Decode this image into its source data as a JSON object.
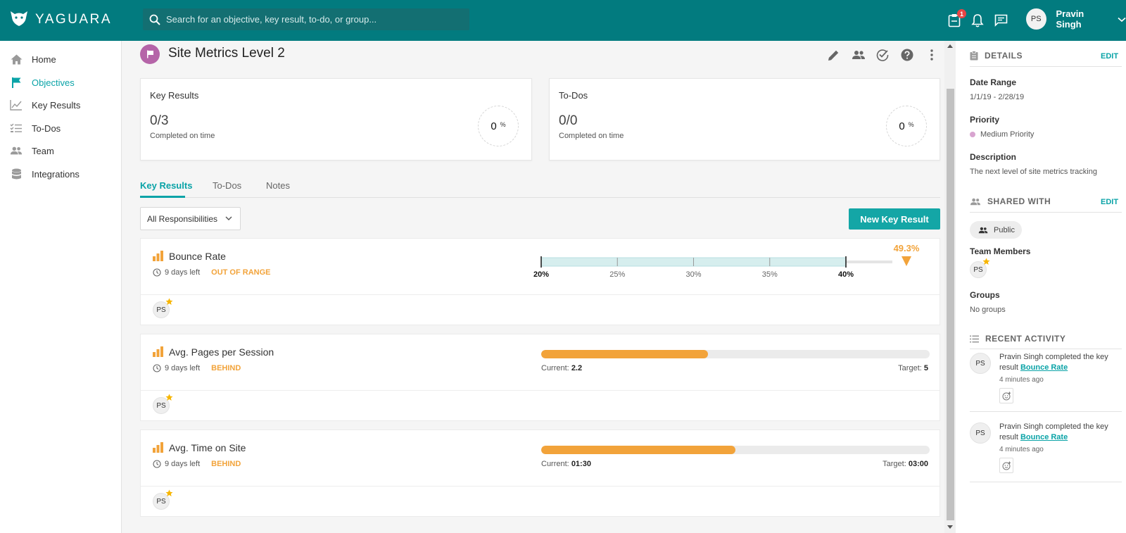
{
  "app": {
    "brand": "YAGUARA",
    "brand_color": "#027b7f",
    "accent": "#0aa3a7"
  },
  "search": {
    "placeholder": "Search for an objective, key result, to-do, or group..."
  },
  "topbar": {
    "notification_badge": "1",
    "user_initials": "PS",
    "user_name": "Pravin Singh"
  },
  "sidebar": {
    "items": [
      {
        "label": "Home",
        "icon": "home-icon"
      },
      {
        "label": "Objectives",
        "icon": "flag-icon"
      },
      {
        "label": "Key Results",
        "icon": "chart-line-icon"
      },
      {
        "label": "To-Dos",
        "icon": "checklist-icon"
      },
      {
        "label": "Team",
        "icon": "team-icon"
      },
      {
        "label": "Integrations",
        "icon": "database-icon"
      }
    ]
  },
  "objective": {
    "title": "Site Metrics Level 2"
  },
  "summary": {
    "key_results": {
      "title": "Key Results",
      "count": "0/3",
      "sub": "Completed on time",
      "percent": "0",
      "pct_symbol": "%"
    },
    "todos": {
      "title": "To-Dos",
      "count": "0/0",
      "sub": "Completed on time",
      "percent": "0",
      "pct_symbol": "%"
    }
  },
  "tabs": [
    "Key Results",
    "To-Dos",
    "Notes"
  ],
  "filter": {
    "label": "All Responsibilities"
  },
  "new_key_result": "New Key Result",
  "key_results": [
    {
      "name": "Bounce Rate",
      "days_left": "9 days left",
      "status": "OUT OF RANGE",
      "range": {
        "ticks": [
          "20%",
          "25%",
          "30%",
          "35%",
          "40%"
        ],
        "min": 20,
        "max": 40,
        "current": 49.3,
        "current_label": "49.3%"
      },
      "owner": "PS"
    },
    {
      "name": "Avg. Pages per Session",
      "days_left": "9 days left",
      "status": "BEHIND",
      "progress": {
        "current_prefix": "Current:",
        "current": "2.2",
        "target_prefix": "Target:",
        "target": "5",
        "fraction": 0.43
      },
      "owner": "PS"
    },
    {
      "name": "Avg. Time on Site",
      "days_left": "9 days left",
      "status": "BEHIND",
      "progress": {
        "current_prefix": "Current:",
        "current": "01:30",
        "target_prefix": "Target:",
        "target": "03:00",
        "fraction": 0.5
      },
      "owner": "PS"
    }
  ],
  "details": {
    "heading": "DETAILS",
    "edit": "EDIT",
    "date_range_label": "Date Range",
    "date_range": "1/1/19 - 2/28/19",
    "priority_label": "Priority",
    "priority": "Medium Priority",
    "description_label": "Description",
    "description": "The next level of site metrics tracking"
  },
  "shared": {
    "heading": "SHARED WITH",
    "edit": "EDIT",
    "visibility": "Public",
    "team_members_label": "Team Members",
    "member": "PS",
    "groups_label": "Groups",
    "groups": "No groups"
  },
  "activity": {
    "heading": "RECENT ACTIVITY",
    "items": [
      {
        "initials": "PS",
        "text": "Pravin Singh completed the key result ",
        "link": "Bounce Rate",
        "time": "4 minutes ago"
      },
      {
        "initials": "PS",
        "text": "Pravin Singh completed the key result ",
        "link": "Bounce Rate",
        "time": "4 minutes ago"
      }
    ]
  }
}
